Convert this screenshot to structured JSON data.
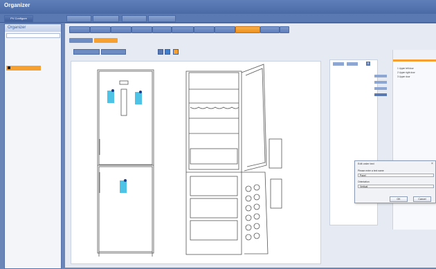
{
  "app": {
    "title": "Organizer"
  },
  "topnav": [
    "PV Configure",
    "",
    "",
    "",
    "",
    "",
    ""
  ],
  "sidebar": {
    "title": "Organizer",
    "selected_item": ""
  },
  "tabs": [
    "",
    "",
    "",
    "",
    "",
    "",
    "",
    "",
    "",
    "",
    ""
  ],
  "active_tab_index": 9,
  "subtabs": [
    "",
    ""
  ],
  "active_subtab_index": 1,
  "toolbar": {
    "btn1": "",
    "btn2": ""
  },
  "right_pane": {
    "btn1": "",
    "btn2": "",
    "close": "x"
  },
  "wardrobe": {
    "title": "",
    "items": [
      "1 Upper left door",
      "2 Upper right door",
      "3 Upper door"
    ]
  },
  "canvas_tags": [
    "",
    "",
    ""
  ],
  "dialog": {
    "title": "Edit order text",
    "field1_label": "Please enter a text name",
    "field1_value": "Panel",
    "field2_label": "Orientation",
    "field2_value": "Vertical",
    "ok": "OK",
    "cancel": "Cancel"
  },
  "colors": {
    "accent": "#f5a030",
    "nav": "#5a79b2",
    "tag": "#4fc3e6"
  }
}
